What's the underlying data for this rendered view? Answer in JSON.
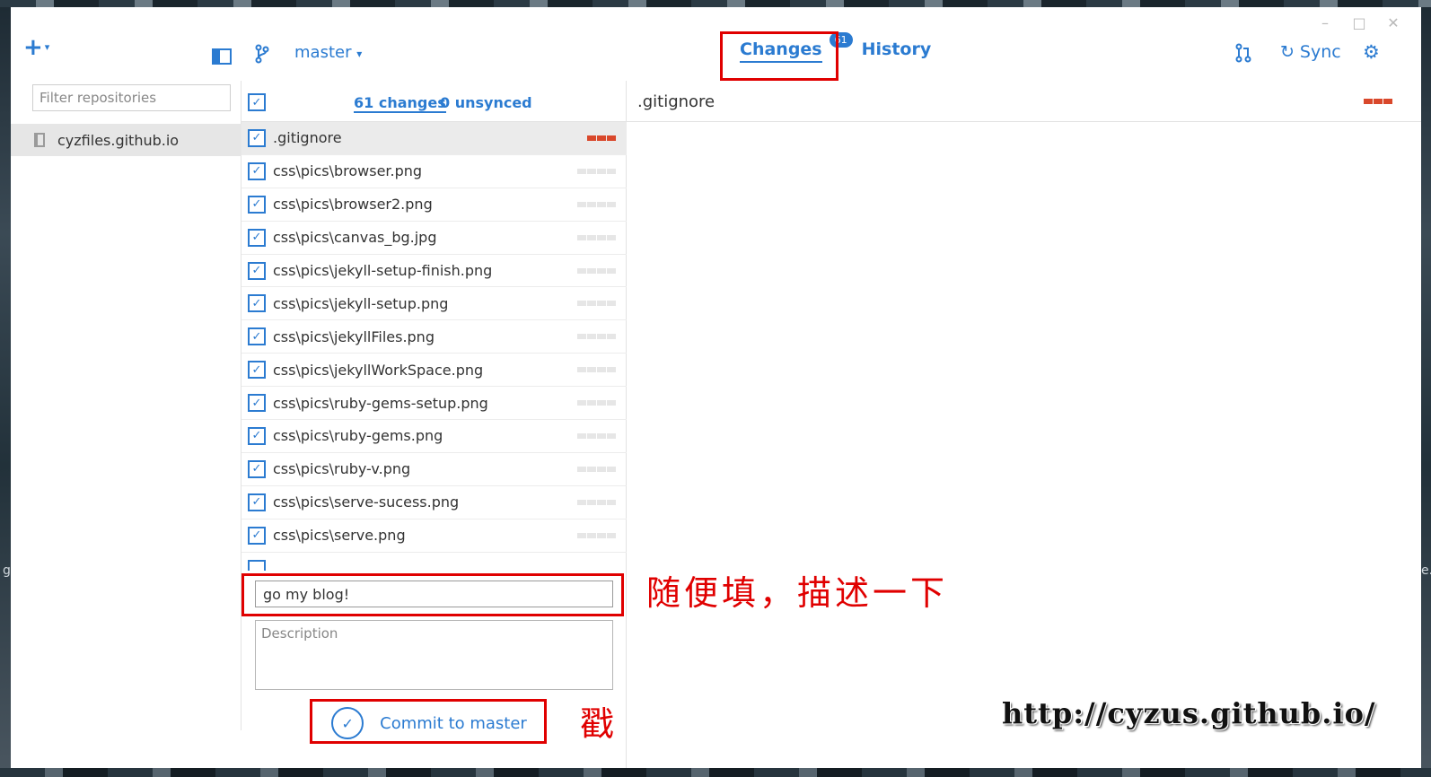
{
  "window": {
    "controls": [
      "–",
      "□",
      "✕"
    ]
  },
  "header": {
    "add_label": "+",
    "add_caret": "▾",
    "branch": "master",
    "branch_caret": "▾",
    "tabs": [
      {
        "label": "Changes",
        "badge": "61",
        "active": true
      },
      {
        "label": "History",
        "active": false
      }
    ],
    "sync_label": "Sync",
    "sync_icon": "↻"
  },
  "sidebar": {
    "filter_placeholder": "Filter repositories",
    "repos": [
      {
        "name": "cyzfiles.github.io",
        "selected": true
      }
    ]
  },
  "changes": {
    "count_label": "61 changes",
    "unsynced_label": "0 unsynced",
    "files": [
      {
        "name": ".gitignore",
        "checked": true,
        "selected": true,
        "diff": "red"
      },
      {
        "name": "css\\pics\\browser.png",
        "checked": true,
        "diff": "gray"
      },
      {
        "name": "css\\pics\\browser2.png",
        "checked": true,
        "diff": "gray"
      },
      {
        "name": "css\\pics\\canvas_bg.jpg",
        "checked": true,
        "diff": "gray"
      },
      {
        "name": "css\\pics\\jekyll-setup-finish.png",
        "checked": true,
        "diff": "gray"
      },
      {
        "name": "css\\pics\\jekyll-setup.png",
        "checked": true,
        "diff": "gray"
      },
      {
        "name": "css\\pics\\jekyllFiles.png",
        "checked": true,
        "diff": "gray"
      },
      {
        "name": "css\\pics\\jekyllWorkSpace.png",
        "checked": true,
        "diff": "gray"
      },
      {
        "name": "css\\pics\\ruby-gems-setup.png",
        "checked": true,
        "diff": "gray"
      },
      {
        "name": "css\\pics\\ruby-gems.png",
        "checked": true,
        "diff": "gray"
      },
      {
        "name": "css\\pics\\ruby-v.png",
        "checked": true,
        "diff": "gray"
      },
      {
        "name": "css\\pics\\serve-sucess.png",
        "checked": true,
        "diff": "gray"
      },
      {
        "name": "css\\pics\\serve.png",
        "checked": true,
        "diff": "gray"
      }
    ],
    "commit_summary_value": "go my blog!",
    "commit_description_placeholder": "Description",
    "commit_button_label": "Commit to master"
  },
  "diff": {
    "title": ".gitignore"
  },
  "annotations": {
    "fill_note": "随便填，描述一下",
    "poke_note": "戳",
    "watermark": "http://cyzus.github.io/"
  },
  "colors": {
    "accent": "#2b7bd1",
    "highlight": "#e00000",
    "diff_red": "#d9482b"
  }
}
